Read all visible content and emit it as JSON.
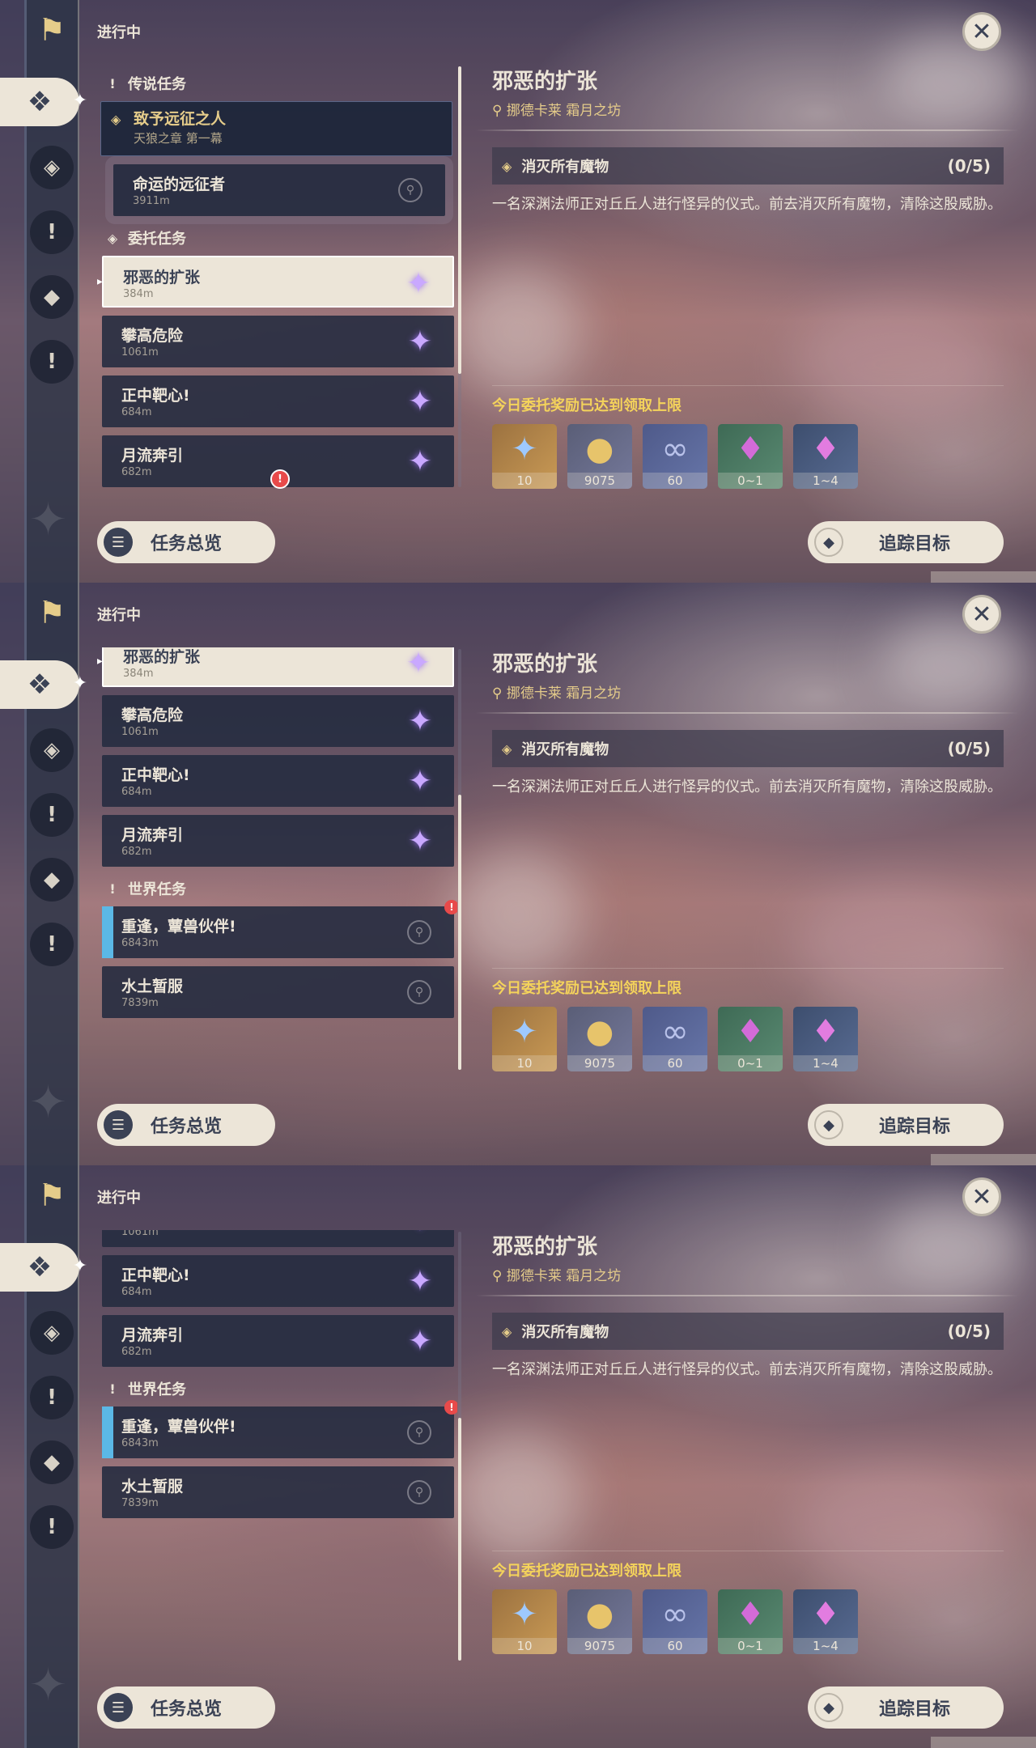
{
  "header": {
    "status": "进行中",
    "close_icon": "close-icon"
  },
  "rail": {
    "icons": [
      "quest-banner-icon",
      "commission-icon",
      "archon-icon",
      "world-icon",
      "story-icon",
      "alert-icon"
    ],
    "active": "commission-icon"
  },
  "sections": {
    "legend": "传说任务",
    "commission": "委托任务",
    "world": "世界任务"
  },
  "legend_quest": {
    "title": "致予远征之人",
    "chapter": "天狼之章 第一幕"
  },
  "legend_sub": {
    "title": "命运的远征者",
    "distance": "3911m"
  },
  "commissions": [
    {
      "title": "邪恶的扩张",
      "distance": "384m",
      "selected": true
    },
    {
      "title": "攀高危险",
      "distance": "1061m"
    },
    {
      "title": "正中靶心!",
      "distance": "684m"
    },
    {
      "title": "月流奔引",
      "distance": "682m"
    }
  ],
  "world_quests": [
    {
      "title": "重逢，蕈兽伙伴!",
      "distance": "6843m",
      "tracked": true,
      "new": true
    },
    {
      "title": "水土暂服",
      "distance": "7839m"
    }
  ],
  "buttons": {
    "overview": "任务总览",
    "track": "追踪目标"
  },
  "detail": {
    "title": "邪恶的扩张",
    "location": "挪德卡莱 霜月之坊",
    "objective": "消灭所有魔物",
    "progress": "(0/5)",
    "description": "一名深渊法师正对丘丘人进行怪异的仪式。前去消灭所有魔物，清除这股威胁。",
    "reward_notice": "今日委托奖励已达到领取上限",
    "rewards": [
      {
        "icon": "primogem-icon",
        "count": "10"
      },
      {
        "icon": "mora-icon",
        "count": "9075"
      },
      {
        "icon": "friendship-icon",
        "count": "60"
      },
      {
        "icon": "crystal-icon",
        "count": "0~1"
      },
      {
        "icon": "crystal-cluster-icon",
        "count": "1~4"
      }
    ]
  },
  "colors": {
    "accent_gold": "#e5cc8a",
    "reward_notice": "#f4d35b",
    "panel_light": "#ece5d8",
    "alert": "#e84a4a"
  }
}
